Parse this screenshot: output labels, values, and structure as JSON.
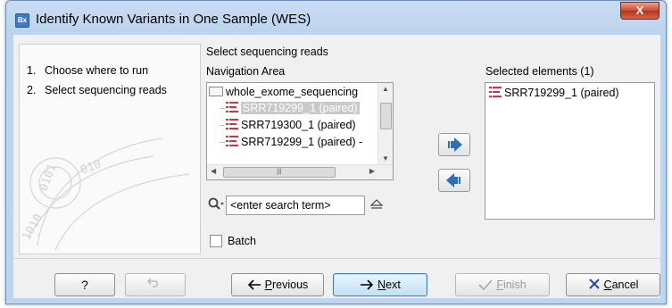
{
  "window": {
    "title": "Identify Known Variants in One Sample (WES)",
    "app_icon": "Bx",
    "close_glyph": "X"
  },
  "steps": [
    {
      "num": "1.",
      "label": "Choose where to run"
    },
    {
      "num": "2.",
      "label": "Select sequencing reads"
    }
  ],
  "content": {
    "subtitle": "Select sequencing reads",
    "nav_label": "Navigation Area",
    "selected_label": "Selected elements (1)",
    "tree": {
      "folder": "whole_exome_sequencing",
      "items": [
        "SRR719299_1 (paired)",
        "SRR719300_1 (paired)",
        "SRR719299_1 (paired) -"
      ]
    },
    "selected_items": [
      "SRR719299_1 (paired)"
    ],
    "search_placeholder": "<enter search term>",
    "batch_label": "Batch"
  },
  "buttons": {
    "help": "?",
    "prev_pre": "",
    "prev_u": "P",
    "prev_post": "revious",
    "next_u": "N",
    "next_post": "ext",
    "finish_u": "F",
    "finish_post": "inish",
    "cancel_u": "C",
    "cancel_post": "ancel"
  },
  "colors": {
    "titlebar": "#c9dcf2",
    "accent_arrow": "#2f6fb5",
    "reads_icon": "#d4343c"
  }
}
